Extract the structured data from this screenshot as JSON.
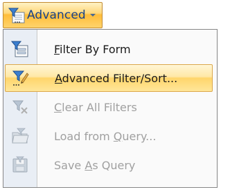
{
  "ribbon_button": {
    "label": "Advanced",
    "icon": "filter-advanced-icon",
    "dropdown_icon": "dropdown-arrow-icon"
  },
  "menu": {
    "items": [
      {
        "prefix": "",
        "accel": "F",
        "suffix": "ilter By Form",
        "icon": "filter-by-form-icon",
        "state": "enabled"
      },
      {
        "prefix": "",
        "accel": "A",
        "suffix": "dvanced Filter/Sort...",
        "icon": "advanced-filter-sort-icon",
        "state": "highlighted"
      },
      {
        "prefix": "",
        "accel": "C",
        "suffix": "lear All Filters",
        "icon": "clear-filters-icon",
        "state": "disabled"
      },
      {
        "prefix": "Load from ",
        "accel": "Q",
        "suffix": "uery...",
        "icon": "load-from-query-icon",
        "state": "disabled"
      },
      {
        "prefix": "Save ",
        "accel": "A",
        "suffix": "s Query",
        "icon": "save-as-query-icon",
        "state": "disabled"
      }
    ]
  },
  "colors": {
    "highlight": "#ffd56b",
    "highlight_border": "#dba74a",
    "disabled_text": "#a0a0a0",
    "button_text": "#15428b"
  }
}
